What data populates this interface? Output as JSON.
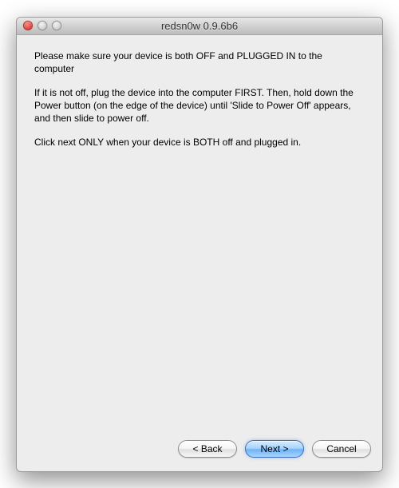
{
  "window": {
    "title": "redsn0w 0.9.6b6"
  },
  "content": {
    "p1": "Please make sure your device is both OFF and PLUGGED IN to the computer",
    "p2": "If it is not off, plug the device into the computer FIRST. Then, hold down the Power button (on the edge of the device) until 'Slide to Power Off' appears, and then slide to power off.",
    "p3": "Click next ONLY when your device is BOTH off and plugged in."
  },
  "buttons": {
    "back": "< Back",
    "next": "Next >",
    "cancel": "Cancel"
  }
}
